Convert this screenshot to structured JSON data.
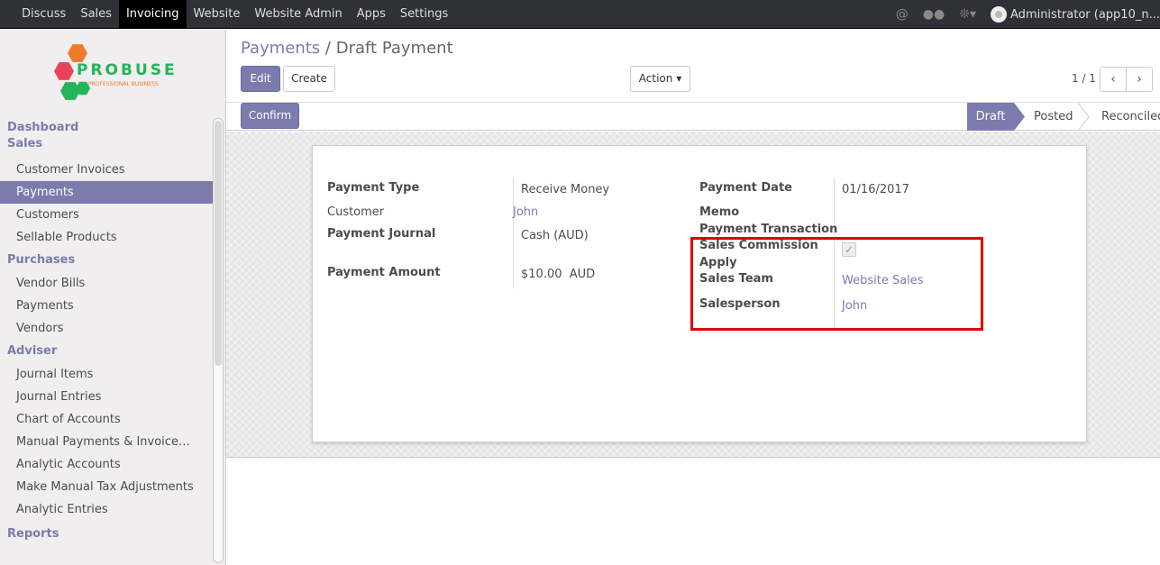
{
  "topbar": {
    "menu": [
      "Discuss",
      "Sales",
      "Invoicing",
      "Website",
      "Website Admin",
      "Apps",
      "Settings"
    ],
    "active": "Invoicing",
    "user": "Administrator (app10_n..."
  },
  "logo": {
    "brand": "PROBUSE",
    "tagline": "PROFESSIONAL BUSINESS"
  },
  "sidebar": {
    "dashboard": "Dashboard",
    "sales": {
      "title": "Sales",
      "items": [
        "Customer Invoices",
        "Payments",
        "Customers",
        "Sellable Products"
      ]
    },
    "purchases": {
      "title": "Purchases",
      "items": [
        "Vendor Bills",
        "Payments",
        "Vendors"
      ]
    },
    "adviser": {
      "title": "Adviser",
      "items": [
        "Journal Items",
        "Journal Entries",
        "Chart of Accounts",
        "Manual Payments & Invoice…",
        "Analytic Accounts",
        "Make Manual Tax Adjustments",
        "Analytic Entries"
      ]
    },
    "reports": "Reports"
  },
  "breadcrumb": {
    "parent": "Payments",
    "sep": "/",
    "current": "Draft Payment"
  },
  "buttons": {
    "edit": "Edit",
    "create": "Create",
    "action": "Action",
    "confirm": "Confirm"
  },
  "pager": {
    "value": "1 / 1"
  },
  "status": {
    "stages": [
      "Draft",
      "Posted",
      "Reconciled"
    ],
    "active": "Draft"
  },
  "form": {
    "payment_type_label": "Payment Type",
    "payment_type": "Receive Money",
    "customer_label": "Customer",
    "customer": "John",
    "journal_label": "Payment Journal",
    "journal": "Cash (AUD)",
    "amount_label": "Payment Amount",
    "amount": "$10.00",
    "currency": "AUD",
    "date_label": "Payment Date",
    "date": "01/16/2017",
    "memo_label": "Memo",
    "transaction_label": "Payment Transaction",
    "commission_label_1": "Sales Commission",
    "commission_label_2": "Apply",
    "commission_checked": true,
    "team_label": "Sales Team",
    "team": "Website Sales",
    "salesperson_label": "Salesperson",
    "salesperson": "John"
  }
}
